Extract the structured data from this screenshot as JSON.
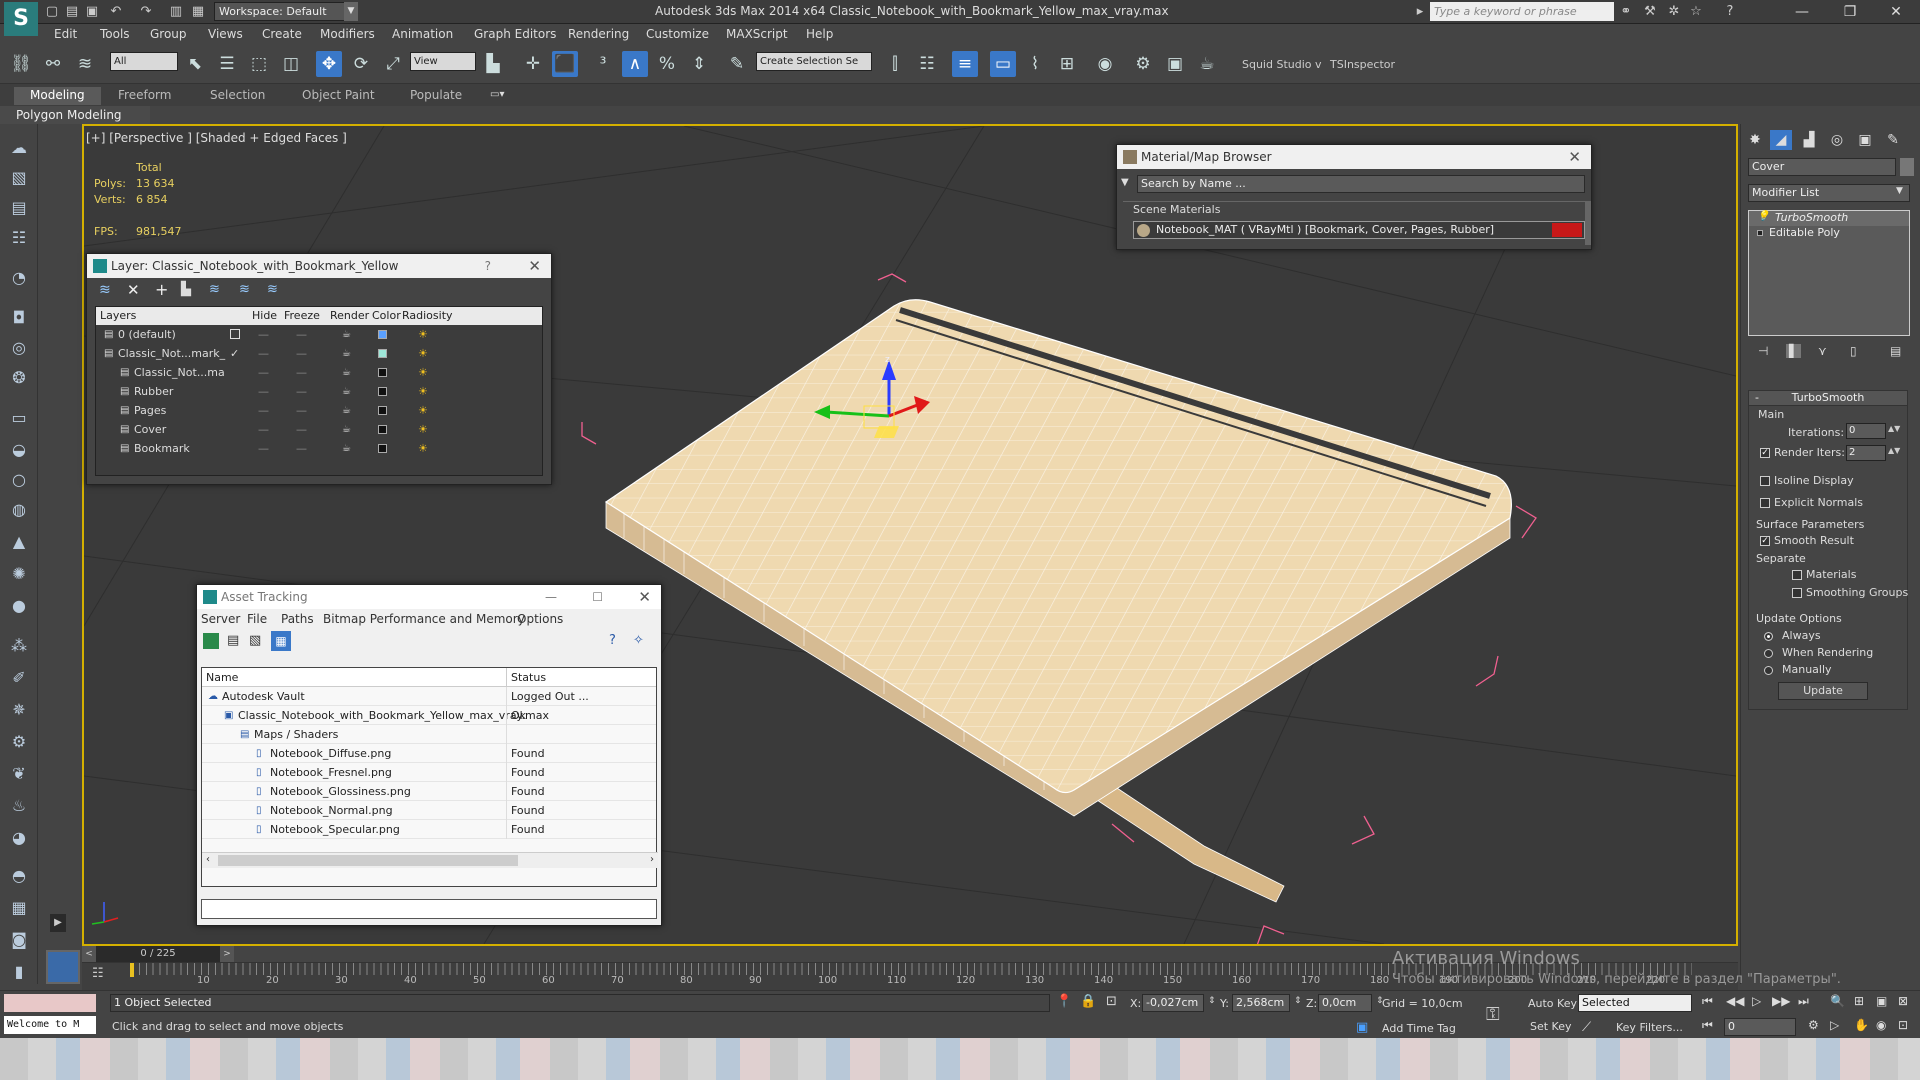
{
  "titlebar": {
    "workspace": "Workspace: Default",
    "title": "Autodesk 3ds Max  2014 x64     Classic_Notebook_with_Bookmark_Yellow_max_vray.max",
    "search_placeholder": "Type a keyword or phrase"
  },
  "menu": [
    "Edit",
    "Tools",
    "Group",
    "Views",
    "Create",
    "Modifiers",
    "Animation",
    "Graph Editors",
    "Rendering",
    "Customize",
    "MAXScript",
    "Help"
  ],
  "toolbar": {
    "filter": "All",
    "refcoord": "View",
    "selection_set": "Create Selection Se",
    "squid": "Squid Studio v",
    "tsinspector": "TSInspector"
  },
  "ribbon": {
    "tabs": [
      "Modeling",
      "Freeform",
      "Selection",
      "Object Paint",
      "Populate"
    ],
    "sub": "Polygon Modeling"
  },
  "viewport": {
    "label": "[+] [Perspective ] [Shaded + Edged Faces ]",
    "stats_total": "Total",
    "polys_label": "Polys:",
    "polys": "13 634",
    "verts_label": "Verts:",
    "verts": "6 854",
    "fps_label": "FPS:",
    "fps": "981,547"
  },
  "layer_window": {
    "title": "Layer: Classic_Notebook_with_Bookmark_Yellow",
    "help": "?",
    "columns": [
      "Layers",
      "Hide",
      "Freeze",
      "Render",
      "Color",
      "Radiosity"
    ],
    "rows": [
      {
        "name": "0 (default)",
        "color": "#5aa0ff"
      },
      {
        "name": "Classic_Not...mark_",
        "color": "#9ee7d8"
      },
      {
        "name": "Classic_Not...ma",
        "color": "#111111"
      },
      {
        "name": "Rubber",
        "color": "#111111"
      },
      {
        "name": "Pages",
        "color": "#111111"
      },
      {
        "name": "Cover",
        "color": "#111111"
      },
      {
        "name": "Bookmark",
        "color": "#111111"
      }
    ]
  },
  "material_browser": {
    "title": "Material/Map Browser",
    "search_placeholder": "Search by Name ...",
    "section": "Scene Materials",
    "item": "Notebook_MAT  ( VRayMtl )  [Bookmark, Cover, Pages, Rubber]"
  },
  "asset_tracking": {
    "title": "Asset Tracking",
    "menu": [
      "Server",
      "File",
      "Paths",
      "Bitmap Performance and Memory",
      "Options"
    ],
    "columns": [
      "Name",
      "Status"
    ],
    "rows": [
      {
        "name": "Autodesk Vault",
        "status": "Logged Out ...",
        "indent": 0
      },
      {
        "name": "Classic_Notebook_with_Bookmark_Yellow_max_vray.max",
        "status": "Ok",
        "indent": 1
      },
      {
        "name": "Maps / Shaders",
        "status": "",
        "indent": 2
      },
      {
        "name": "Notebook_Diffuse.png",
        "status": "Found",
        "indent": 3
      },
      {
        "name": "Notebook_Fresnel.png",
        "status": "Found",
        "indent": 3
      },
      {
        "name": "Notebook_Glossiness.png",
        "status": "Found",
        "indent": 3
      },
      {
        "name": "Notebook_Normal.png",
        "status": "Found",
        "indent": 3
      },
      {
        "name": "Notebook_Specular.png",
        "status": "Found",
        "indent": 3
      }
    ]
  },
  "command_panel": {
    "object_name": "Cover",
    "modifier_list": "Modifier List",
    "stack": [
      "TurboSmooth",
      "Editable Poly"
    ],
    "rollout": "TurboSmooth",
    "main": "Main",
    "iterations_label": "Iterations:",
    "iterations": "0",
    "render_iters_label": "Render Iters:",
    "render_iters": "2",
    "isoline": "Isoline Display",
    "explicit": "Explicit Normals",
    "surface": "Surface Parameters",
    "smooth_result": "Smooth Result",
    "separate": "Separate",
    "materials": "Materials",
    "smoothing_groups": "Smoothing Groups",
    "update_options": "Update Options",
    "always": "Always",
    "when_rendering": "When Rendering",
    "manually": "Manually",
    "update": "Update"
  },
  "timeline": {
    "frame": "0 / 225",
    "ticks": [
      "10",
      "20",
      "30",
      "40",
      "50",
      "60",
      "70",
      "80",
      "90",
      "100",
      "110",
      "120",
      "130",
      "140",
      "150",
      "160",
      "170",
      "180",
      "190",
      "200",
      "210",
      "220"
    ]
  },
  "status": {
    "selected": "1 Object Selected",
    "prompt": "Click and drag to select and move objects",
    "maxscript": "Welcome to M",
    "x_label": "X:",
    "x": "-0,027cm",
    "y_label": "Y:",
    "y": "2,568cm",
    "z_label": "Z:",
    "z": "0,0cm",
    "grid": "Grid = 10,0cm",
    "auto_key": "Auto Key",
    "set_key": "Set Key",
    "key_mode": "Selected",
    "key_filters": "Key Filters...",
    "add_time_tag": "Add Time Tag",
    "frame_field": "0",
    "activation_1": "Активация Windows",
    "activation_2": "Чтобы активировать Windows, перейдите в раздел \"Параметры\"."
  }
}
